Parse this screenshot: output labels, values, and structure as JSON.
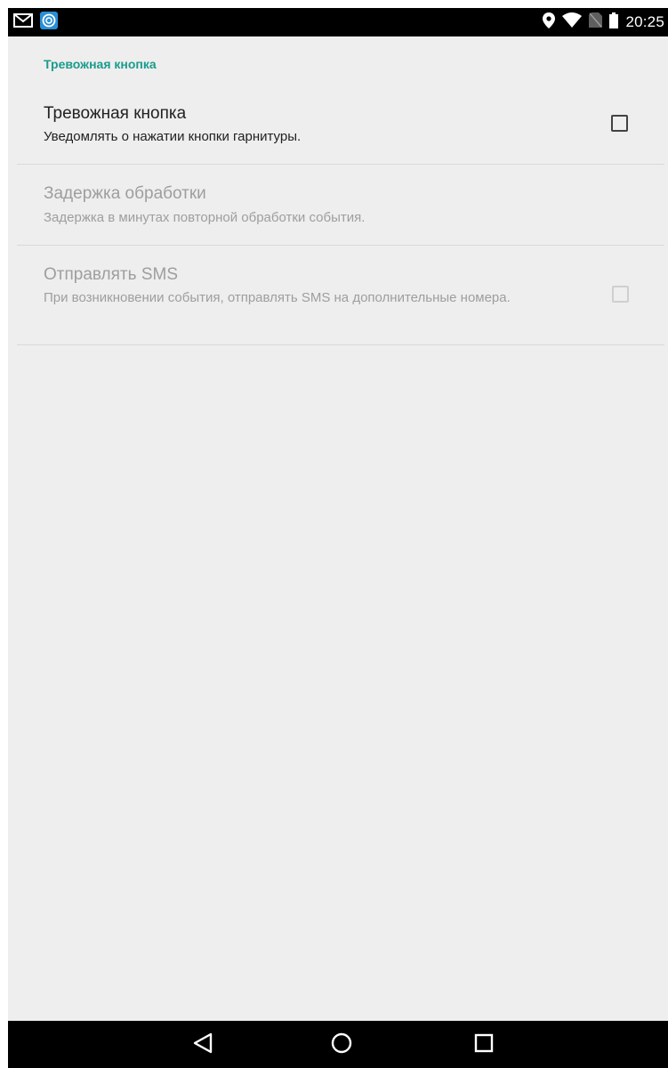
{
  "status_bar": {
    "time": "20:25",
    "left_icons": [
      "mail-icon",
      "app-notification-icon"
    ],
    "right_icons": [
      "location-icon",
      "wifi-icon",
      "no-sim-icon",
      "battery-icon"
    ]
  },
  "settings": {
    "category_title": "Тревожная кнопка",
    "items": [
      {
        "title": "Тревожная кнопка",
        "summary": "Уведомлять о нажатии кнопки гарнитуры.",
        "has_checkbox": true,
        "checked": false,
        "enabled": true
      },
      {
        "title": "Задержка обработки",
        "summary": "Задержка в минутах повторной обработки события.",
        "has_checkbox": false,
        "enabled": false
      },
      {
        "title": "Отправлять SMS",
        "summary": "При возникновении события, отправлять SMS на дополнительные номера.",
        "has_checkbox": true,
        "checked": false,
        "enabled": false
      }
    ]
  },
  "nav_bar": {
    "buttons": [
      "back-icon",
      "home-icon",
      "recents-icon"
    ]
  },
  "colors": {
    "accent": "#1a9c8c",
    "background": "#eeeeee",
    "text_primary": "#212121",
    "text_disabled": "#9e9e9e",
    "divider": "#d9d9d9"
  }
}
